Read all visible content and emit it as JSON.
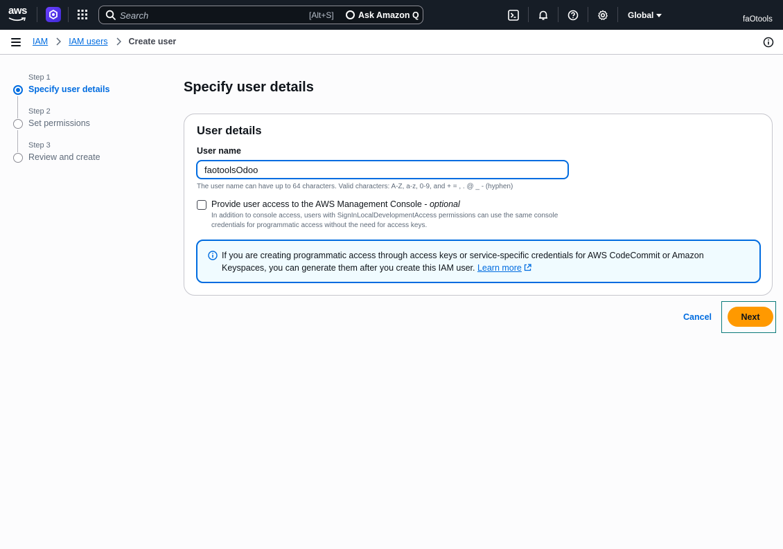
{
  "topnav": {
    "logo_text": "aws",
    "search": {
      "placeholder": "Search",
      "shortcut": "[Alt+S]"
    },
    "ask_q_label": "Ask Amazon Q",
    "region": "Global",
    "account": "faOtools"
  },
  "breadcrumb": {
    "items": [
      "IAM",
      "IAM users"
    ],
    "current": "Create user"
  },
  "steps": [
    {
      "step_label": "Step 1",
      "title": "Specify user details"
    },
    {
      "step_label": "Step 2",
      "title": "Set permissions"
    },
    {
      "step_label": "Step 3",
      "title": "Review and create"
    }
  ],
  "main": {
    "page_title": "Specify user details",
    "panel_title": "User details",
    "username_label": "User name",
    "username_value": "faotoolsOdoo",
    "username_constraint": "The user name can have up to 64 characters. Valid characters: A-Z, a-z, 0-9, and + = , . @ _ - (hyphen)",
    "console_checkbox_label": "Provide user access to the AWS Management Console - ",
    "console_checkbox_optional": "optional",
    "console_checkbox_desc": "In addition to console access, users with SignInLocalDevelopmentAccess permissions can use the same console credentials for programmatic access without the need for access keys.",
    "alert_text": "If you are creating programmatic access through access keys or service-specific credentials for AWS CodeCommit or Amazon Keyspaces, you can generate them after you create this IAM user. ",
    "alert_link": "Learn more"
  },
  "actions": {
    "cancel_label": "Cancel",
    "next_label": "Next"
  },
  "colors": {
    "accent": "#006ce0",
    "primary_button": "#ff9900",
    "topnav_bg": "#161d26"
  }
}
